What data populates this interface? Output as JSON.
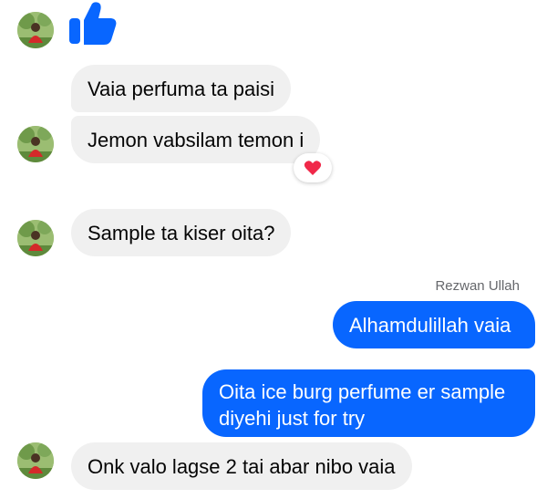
{
  "conversation": {
    "messages": [
      {
        "type": "sticker",
        "icon": "thumbs-up-icon"
      },
      {
        "text": "Vaia perfuma ta paisi"
      },
      {
        "text": "Jemon vabsilam temon i",
        "reaction": "heart-icon"
      },
      {
        "text": "Sample ta kiser oita?"
      },
      {
        "text": "Alhamdulillah vaia"
      },
      {
        "line1": "Oita ice burg perfume er sample",
        "line2": "diyehi just for try"
      },
      {
        "text": "Onk valo lagse 2 tai abar nibo vaia"
      }
    ],
    "sender_label": "Rezwan Ullah"
  },
  "colors": {
    "accent": "#0866ff",
    "incoming_bubble": "#f0f0f0",
    "reaction_heart": "#f02849"
  }
}
